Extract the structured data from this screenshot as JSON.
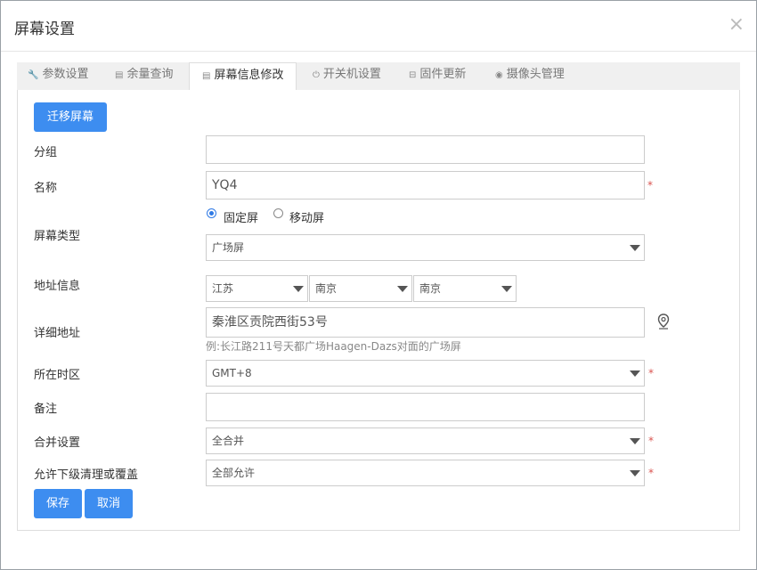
{
  "dialog": {
    "title": "屏幕设置",
    "close_icon": "×"
  },
  "tabs": [
    {
      "label": "参数设置",
      "icon": "wrench-icon",
      "glyph": "🔧"
    },
    {
      "label": "余量查询",
      "icon": "document-icon",
      "glyph": "▤"
    },
    {
      "label": "屏幕信息修改",
      "icon": "document-icon",
      "glyph": "▤"
    },
    {
      "label": "开关机设置",
      "icon": "power-icon",
      "glyph": "⏻"
    },
    {
      "label": "固件更新",
      "icon": "hdd-icon",
      "glyph": "⊟"
    },
    {
      "label": "摄像头管理",
      "icon": "camera-icon",
      "glyph": "◉"
    }
  ],
  "active_tab": "屏幕信息修改",
  "form": {
    "migrate_button": "迁移屏幕",
    "group": {
      "label": "分组",
      "value": ""
    },
    "name": {
      "label": "名称",
      "value": "YQ4",
      "required": "*"
    },
    "screen_type": {
      "label": "屏幕类型",
      "radio_fixed": "固定屏",
      "radio_mobile": "移动屏",
      "selected_radio": "固定屏",
      "select_value": "广场屏"
    },
    "address_info": {
      "label": "地址信息",
      "province": "江苏",
      "city": "南京",
      "district": "南京"
    },
    "detail_address": {
      "label": "详细地址",
      "value": "秦淮区贡院西街53号",
      "hint": "例:长江路211号天都广场Haagen-Dazs对面的广场屏",
      "icon": "map-marker-icon"
    },
    "timezone": {
      "label": "所在时区",
      "value": "GMT+8",
      "required": "*"
    },
    "remark": {
      "label": "备注",
      "value": ""
    },
    "merge": {
      "label": "合并设置",
      "value": "全合并",
      "required": "*"
    },
    "allow_clean": {
      "label": "允许下级清理或覆盖",
      "value": "全部允许",
      "required": "*"
    },
    "save_button": "保存",
    "cancel_button": "取消"
  },
  "colors": {
    "primary": "#3d8df0",
    "required": "#d9534f",
    "tab_bar": "#f0f0f0"
  }
}
